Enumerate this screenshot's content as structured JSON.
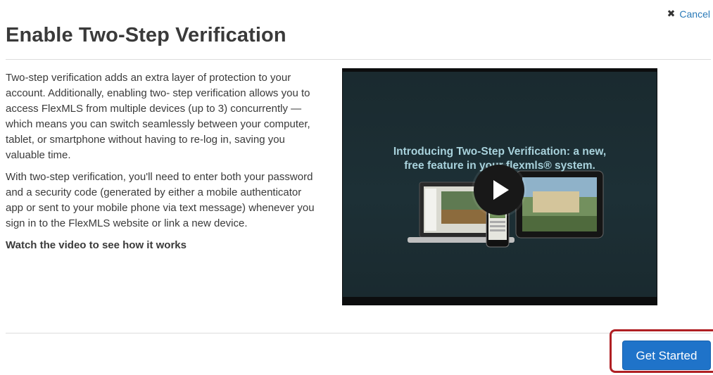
{
  "header": {
    "cancel_label": "Cancel",
    "title": "Enable Two-Step Verification"
  },
  "content": {
    "paragraph_1": "Two-step verification adds an extra layer of protection to your account. Additionally, enabling two- step verification allows you to access FlexMLS from multiple devices (up to 3) concurrently — which means you can switch seamlessly between your computer, tablet, or smartphone without having to re-log in, saving you valuable time.",
    "paragraph_2": "With two-step verification, you'll need to enter both your password and a security code (generated by either a mobile authenticator app or sent to your mobile phone via text message) whenever you sign in to the FlexMLS website or link a new device.",
    "watch_prompt": "Watch the video to see how it works"
  },
  "video": {
    "caption_line_1": "Introducing Two-Step Verification: a new,",
    "caption_line_2": "free feature in your flexmls® system.",
    "play_icon": "play-icon"
  },
  "footer": {
    "get_started_label": "Get Started"
  },
  "colors": {
    "link": "#2a7ab8",
    "primary_button": "#1f73c9",
    "highlight_border": "#b01f23",
    "video_caption": "#a8d2dc"
  }
}
